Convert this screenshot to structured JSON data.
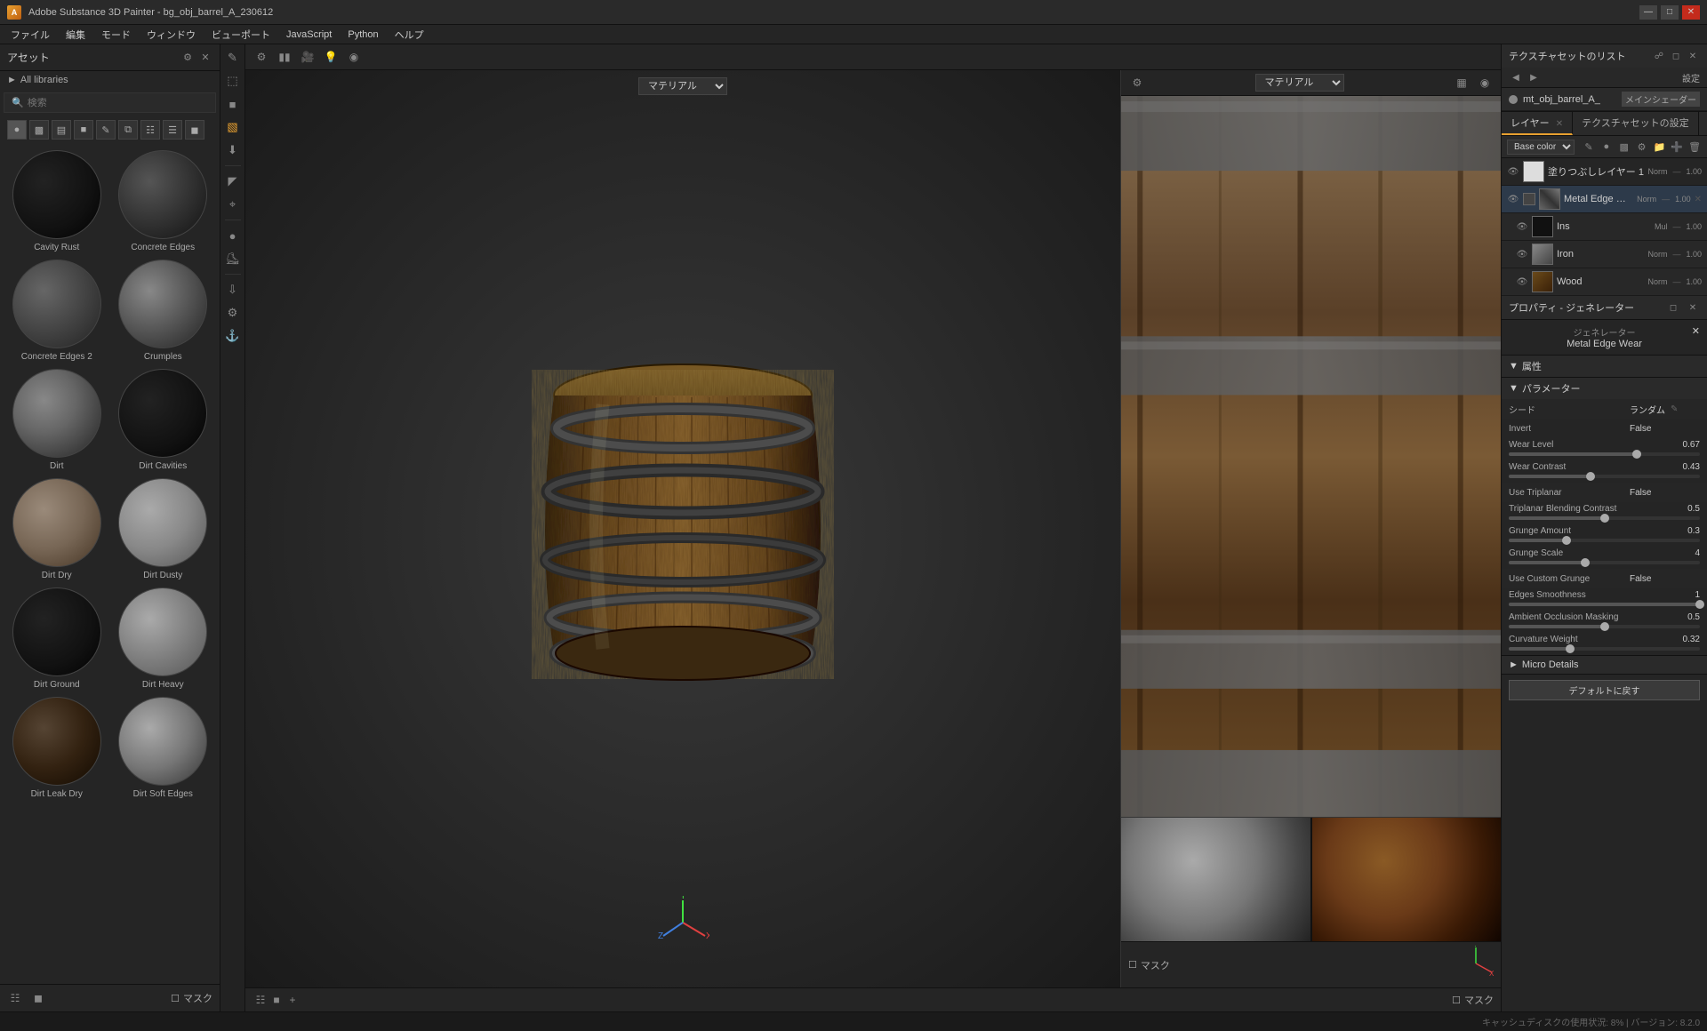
{
  "titlebar": {
    "title": "Adobe Substance 3D Painter - bg_obj_barrel_A_230612",
    "icon": "A",
    "controls": [
      "minimize",
      "maximize",
      "close"
    ]
  },
  "menubar": {
    "items": [
      "ファイル",
      "編集",
      "モード",
      "ウィンドウ",
      "ビューポート",
      "JavaScript",
      "Python",
      "ヘルプ"
    ]
  },
  "sidebar": {
    "title": "アセット",
    "search_placeholder": "検索",
    "all_libraries_label": "All libraries",
    "assets": [
      {
        "name": "Cavity Rust",
        "sphere_class": "sphere-cavity-rust"
      },
      {
        "name": "Concrete Edges",
        "sphere_class": "sphere-concrete-edges"
      },
      {
        "name": "Concrete Edges 2",
        "sphere_class": "sphere-concrete-edges2"
      },
      {
        "name": "Crumples",
        "sphere_class": "sphere-crumples"
      },
      {
        "name": "Dirt",
        "sphere_class": "sphere-dirt"
      },
      {
        "name": "Dirt Cavities",
        "sphere_class": "sphere-dirt-cavities"
      },
      {
        "name": "Dirt Dry",
        "sphere_class": "sphere-dirt-dry"
      },
      {
        "name": "Dirt Dusty",
        "sphere_class": "sphere-dirt-dusty"
      },
      {
        "name": "Dirt Ground",
        "sphere_class": "sphere-dirt-ground"
      },
      {
        "name": "Dirt Heavy",
        "sphere_class": "sphere-dirt-heavy"
      },
      {
        "name": "Dirt Leak Dry",
        "sphere_class": "sphere-dirt-leak"
      },
      {
        "name": "Dirt Soft Edges",
        "sphere_class": "sphere-dirt-soft"
      }
    ],
    "mask_label": "マスク"
  },
  "viewport": {
    "material_select_label": "マテリアル",
    "material_select2_label": "マテリアル",
    "mask_label": "マスク"
  },
  "right_panel": {
    "texture_set_list_title": "テクスチャセットのリスト",
    "settings_label": "設定",
    "texture_set_name": "mt_obj_barrel_A_",
    "texture_set_badge": "メインシェーダー",
    "layers_tab": "レイヤー",
    "texture_tab": "テクスチャセットの設定",
    "layers": [
      {
        "name": "塗りつぶしレイヤー 1",
        "blend": "Norm",
        "opacity": "1.00",
        "type": "fill",
        "thumb": "white",
        "visible": true
      },
      {
        "name": "Metal Edge Wear",
        "blend": "Norm",
        "opacity": "1.00",
        "type": "generator",
        "thumb": "metal",
        "visible": true,
        "selected": true
      },
      {
        "name": "Ins",
        "blend": "Mul",
        "opacity": "1.00",
        "type": "sublayer",
        "thumb": "black",
        "visible": true
      },
      {
        "name": "Iron",
        "blend": "Norm",
        "opacity": "1.00",
        "type": "sublayer",
        "thumb": "iron",
        "visible": true
      },
      {
        "name": "Wood",
        "blend": "Norm",
        "opacity": "1.00",
        "type": "sublayer",
        "thumb": "wood",
        "visible": true
      }
    ],
    "properties_title": "プロパティ - ジェネレーター",
    "generator_section_title": "ジェネレーター",
    "generator_name": "Metal Edge Wear",
    "attributes_section": "属性",
    "params_section": "パラメーター",
    "params": [
      {
        "label": "シード",
        "value": "ランダム",
        "has_edit": true
      },
      {
        "label": "Invert",
        "value": "False"
      },
      {
        "label": "Wear Level",
        "value": "0.67",
        "slider": true,
        "fill_pct": 67
      },
      {
        "label": "Wear Contrast",
        "value": "0.43",
        "slider": true,
        "fill_pct": 43
      },
      {
        "label": "Use Triplanar",
        "value": "False"
      },
      {
        "label": "Triplanar Blending Contrast",
        "value": "0.5",
        "slider": true,
        "fill_pct": 50
      },
      {
        "label": "Grunge Amount",
        "value": "0.3",
        "slider": true,
        "fill_pct": 30
      },
      {
        "label": "Grunge Scale",
        "value": "4",
        "slider": true,
        "fill_pct": 40
      },
      {
        "label": "Use Custom Grunge",
        "value": "False"
      },
      {
        "label": "Edges Smoothness",
        "value": "1",
        "slider": true,
        "fill_pct": 100
      },
      {
        "label": "Ambient Occlusion Masking",
        "value": "0.5",
        "slider": true,
        "fill_pct": 50
      },
      {
        "label": "Curvature Weight",
        "value": "0.32",
        "slider": true,
        "fill_pct": 32
      }
    ],
    "micro_details_label": "Micro Details",
    "default_btn_label": "デフォルトに戻す"
  },
  "status_bar": {
    "cache_text": "キャッシュディスクの使用状況: 8% | バージョン: 8.2.0"
  }
}
